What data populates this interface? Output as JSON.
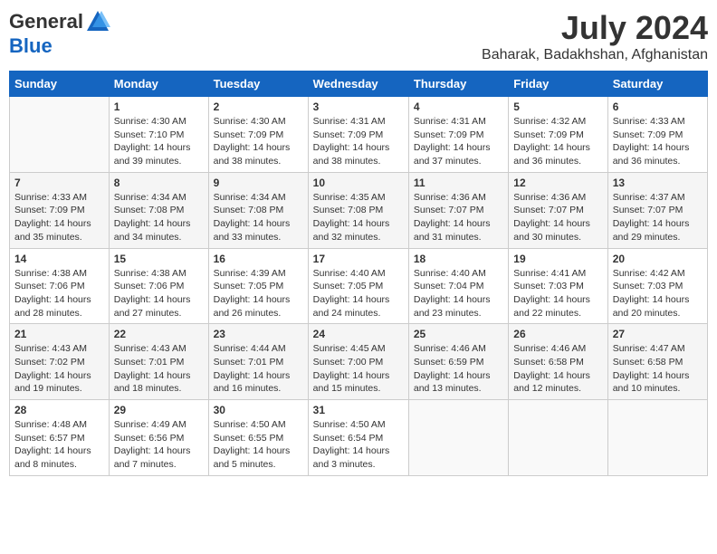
{
  "header": {
    "logo_general": "General",
    "logo_blue": "Blue",
    "month": "July 2024",
    "location": "Baharak, Badakhshan, Afghanistan"
  },
  "days_of_week": [
    "Sunday",
    "Monday",
    "Tuesday",
    "Wednesday",
    "Thursday",
    "Friday",
    "Saturday"
  ],
  "weeks": [
    [
      {
        "day": "",
        "info": ""
      },
      {
        "day": "1",
        "info": "Sunrise: 4:30 AM\nSunset: 7:10 PM\nDaylight: 14 hours\nand 39 minutes."
      },
      {
        "day": "2",
        "info": "Sunrise: 4:30 AM\nSunset: 7:09 PM\nDaylight: 14 hours\nand 38 minutes."
      },
      {
        "day": "3",
        "info": "Sunrise: 4:31 AM\nSunset: 7:09 PM\nDaylight: 14 hours\nand 38 minutes."
      },
      {
        "day": "4",
        "info": "Sunrise: 4:31 AM\nSunset: 7:09 PM\nDaylight: 14 hours\nand 37 minutes."
      },
      {
        "day": "5",
        "info": "Sunrise: 4:32 AM\nSunset: 7:09 PM\nDaylight: 14 hours\nand 36 minutes."
      },
      {
        "day": "6",
        "info": "Sunrise: 4:33 AM\nSunset: 7:09 PM\nDaylight: 14 hours\nand 36 minutes."
      }
    ],
    [
      {
        "day": "7",
        "info": "Sunrise: 4:33 AM\nSunset: 7:09 PM\nDaylight: 14 hours\nand 35 minutes."
      },
      {
        "day": "8",
        "info": "Sunrise: 4:34 AM\nSunset: 7:08 PM\nDaylight: 14 hours\nand 34 minutes."
      },
      {
        "day": "9",
        "info": "Sunrise: 4:34 AM\nSunset: 7:08 PM\nDaylight: 14 hours\nand 33 minutes."
      },
      {
        "day": "10",
        "info": "Sunrise: 4:35 AM\nSunset: 7:08 PM\nDaylight: 14 hours\nand 32 minutes."
      },
      {
        "day": "11",
        "info": "Sunrise: 4:36 AM\nSunset: 7:07 PM\nDaylight: 14 hours\nand 31 minutes."
      },
      {
        "day": "12",
        "info": "Sunrise: 4:36 AM\nSunset: 7:07 PM\nDaylight: 14 hours\nand 30 minutes."
      },
      {
        "day": "13",
        "info": "Sunrise: 4:37 AM\nSunset: 7:07 PM\nDaylight: 14 hours\nand 29 minutes."
      }
    ],
    [
      {
        "day": "14",
        "info": "Sunrise: 4:38 AM\nSunset: 7:06 PM\nDaylight: 14 hours\nand 28 minutes."
      },
      {
        "day": "15",
        "info": "Sunrise: 4:38 AM\nSunset: 7:06 PM\nDaylight: 14 hours\nand 27 minutes."
      },
      {
        "day": "16",
        "info": "Sunrise: 4:39 AM\nSunset: 7:05 PM\nDaylight: 14 hours\nand 26 minutes."
      },
      {
        "day": "17",
        "info": "Sunrise: 4:40 AM\nSunset: 7:05 PM\nDaylight: 14 hours\nand 24 minutes."
      },
      {
        "day": "18",
        "info": "Sunrise: 4:40 AM\nSunset: 7:04 PM\nDaylight: 14 hours\nand 23 minutes."
      },
      {
        "day": "19",
        "info": "Sunrise: 4:41 AM\nSunset: 7:03 PM\nDaylight: 14 hours\nand 22 minutes."
      },
      {
        "day": "20",
        "info": "Sunrise: 4:42 AM\nSunset: 7:03 PM\nDaylight: 14 hours\nand 20 minutes."
      }
    ],
    [
      {
        "day": "21",
        "info": "Sunrise: 4:43 AM\nSunset: 7:02 PM\nDaylight: 14 hours\nand 19 minutes."
      },
      {
        "day": "22",
        "info": "Sunrise: 4:43 AM\nSunset: 7:01 PM\nDaylight: 14 hours\nand 18 minutes."
      },
      {
        "day": "23",
        "info": "Sunrise: 4:44 AM\nSunset: 7:01 PM\nDaylight: 14 hours\nand 16 minutes."
      },
      {
        "day": "24",
        "info": "Sunrise: 4:45 AM\nSunset: 7:00 PM\nDaylight: 14 hours\nand 15 minutes."
      },
      {
        "day": "25",
        "info": "Sunrise: 4:46 AM\nSunset: 6:59 PM\nDaylight: 14 hours\nand 13 minutes."
      },
      {
        "day": "26",
        "info": "Sunrise: 4:46 AM\nSunset: 6:58 PM\nDaylight: 14 hours\nand 12 minutes."
      },
      {
        "day": "27",
        "info": "Sunrise: 4:47 AM\nSunset: 6:58 PM\nDaylight: 14 hours\nand 10 minutes."
      }
    ],
    [
      {
        "day": "28",
        "info": "Sunrise: 4:48 AM\nSunset: 6:57 PM\nDaylight: 14 hours\nand 8 minutes."
      },
      {
        "day": "29",
        "info": "Sunrise: 4:49 AM\nSunset: 6:56 PM\nDaylight: 14 hours\nand 7 minutes."
      },
      {
        "day": "30",
        "info": "Sunrise: 4:50 AM\nSunset: 6:55 PM\nDaylight: 14 hours\nand 5 minutes."
      },
      {
        "day": "31",
        "info": "Sunrise: 4:50 AM\nSunset: 6:54 PM\nDaylight: 14 hours\nand 3 minutes."
      },
      {
        "day": "",
        "info": ""
      },
      {
        "day": "",
        "info": ""
      },
      {
        "day": "",
        "info": ""
      }
    ]
  ]
}
